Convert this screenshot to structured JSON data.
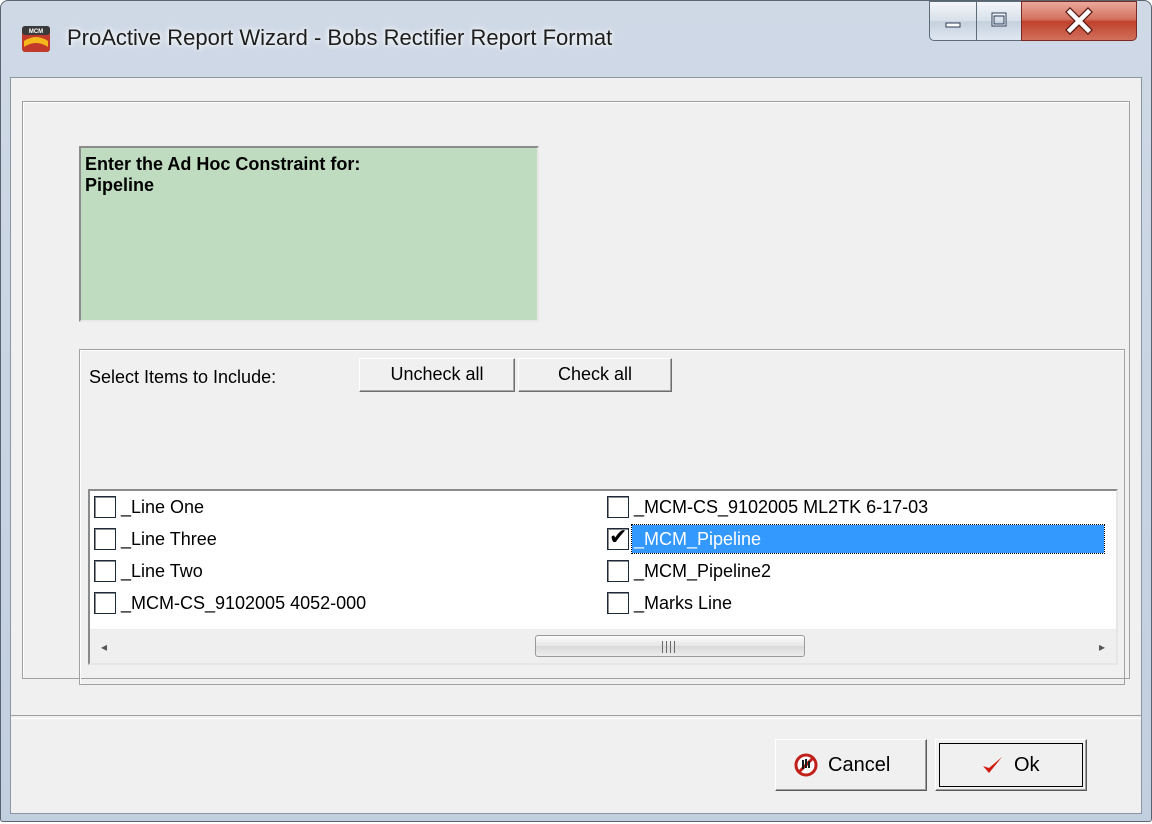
{
  "window": {
    "title": "ProActive Report Wizard - Bobs Rectifier Report Format",
    "icon": "mcm-app-icon",
    "controls": [
      "minimize-icon",
      "maximize-icon",
      "close-icon"
    ]
  },
  "constraint": {
    "text": "Enter the Ad Hoc Constraint for:\nPipeline",
    "background": "#c0dcc0"
  },
  "items": {
    "label": "Select Items to Include:",
    "uncheck_all": "Uncheck all",
    "check_all": "Check all",
    "left_column": [
      {
        "label": "_Line One",
        "checked": false
      },
      {
        "label": "_Line Three",
        "checked": false
      },
      {
        "label": "_Line Two",
        "checked": false
      },
      {
        "label": "_MCM-CS_9102005 4052-000",
        "checked": false
      }
    ],
    "right_column": [
      {
        "label": "_MCM-CS_9102005 ML2TK 6-17-03",
        "checked": false
      },
      {
        "label": "_MCM_Pipeline",
        "checked": true,
        "selected": true
      },
      {
        "label": "_MCM_Pipeline2",
        "checked": false
      },
      {
        "label": "_Marks Line",
        "checked": false
      }
    ],
    "scroll_grip": "III",
    "scroll_left": "◂",
    "scroll_right": "▸"
  },
  "footer": {
    "cancel": "Cancel",
    "ok": "Ok",
    "cancel_icon": "cancel-icon",
    "ok_icon": "checkmark-icon",
    "selection_color": "#3399ff"
  }
}
